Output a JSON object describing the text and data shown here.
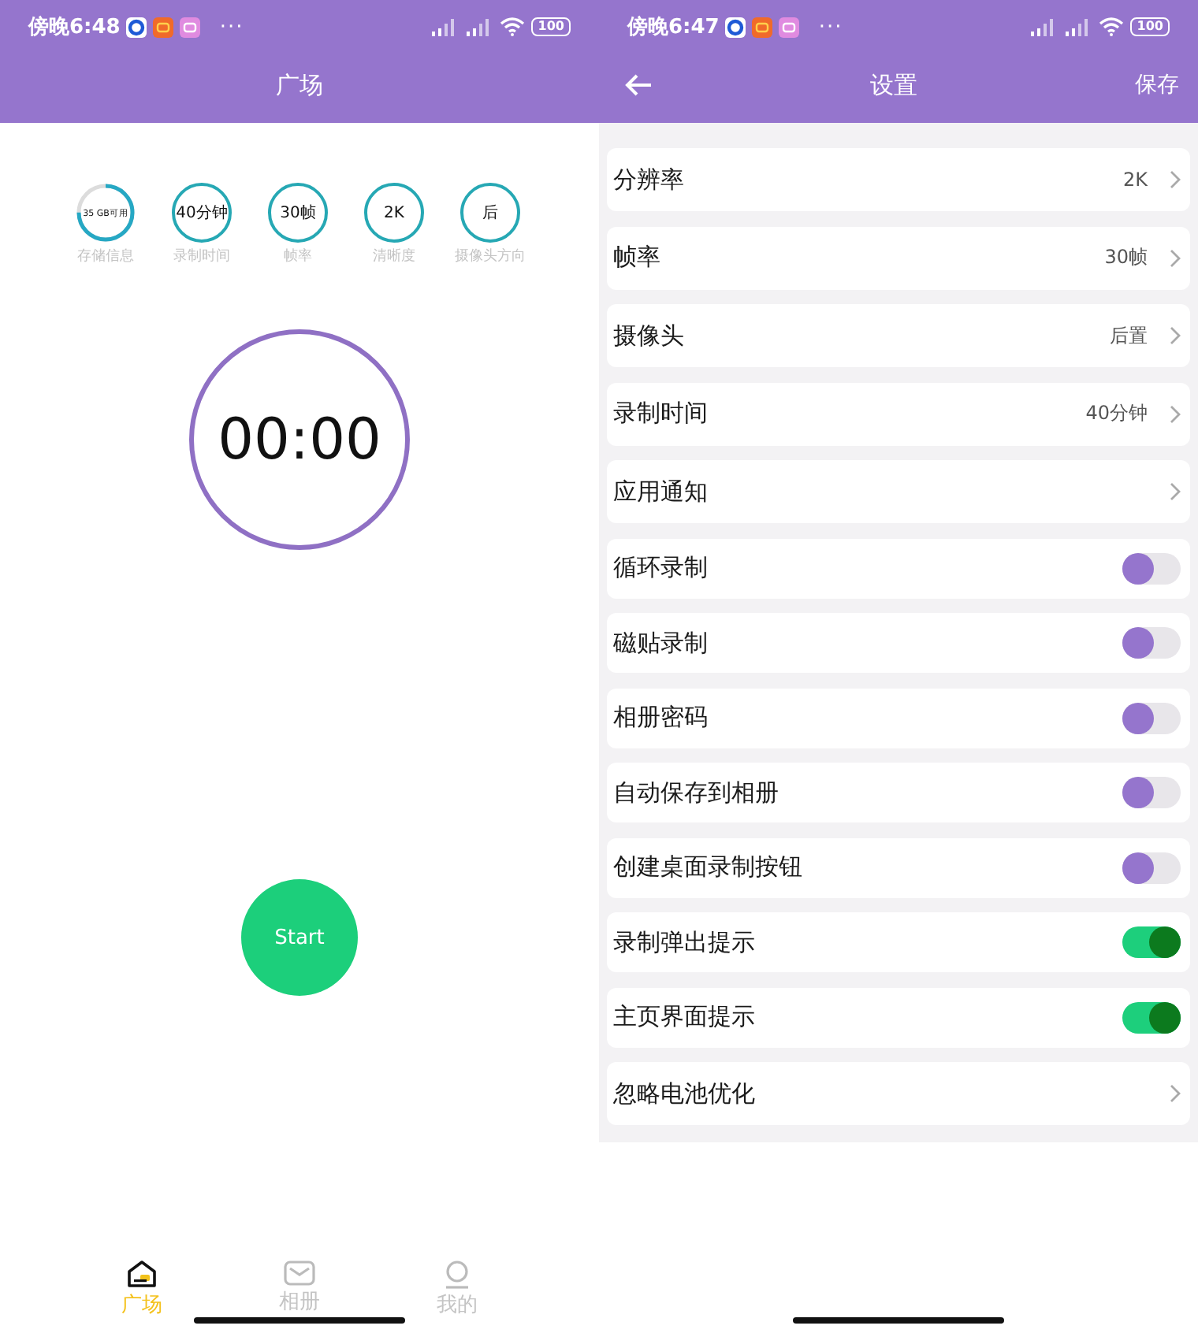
{
  "home_screen": {
    "status_bar": {
      "time": "傍晚6:48",
      "more": "···",
      "battery": "100"
    },
    "title": "广场",
    "stats": [
      {
        "kind": "ring",
        "value": "35 GB可用",
        "level": 0.75,
        "label": "存储信息"
      },
      {
        "kind": "circle",
        "value": "40分钟",
        "label": "录制时间"
      },
      {
        "kind": "circle",
        "value": "30帧",
        "label": "帧率"
      },
      {
        "kind": "circle",
        "value": "2K",
        "label": "清晰度"
      },
      {
        "kind": "circle",
        "value": "后",
        "label": "摄像头方向"
      }
    ],
    "timer": "00:00",
    "start_button": "Start",
    "nav": [
      {
        "label": "广场",
        "selected": true
      },
      {
        "label": "相册",
        "selected": false
      },
      {
        "label": "我的",
        "selected": false
      }
    ]
  },
  "settings_screen": {
    "status_bar": {
      "time": "傍晚6:47",
      "more": "···",
      "battery": "100"
    },
    "title": "设置",
    "save": "保存",
    "rows": [
      {
        "kind": "link",
        "label": "分辨率",
        "value": "2K"
      },
      {
        "kind": "link",
        "label": "帧率",
        "value": "30帧"
      },
      {
        "kind": "link",
        "label": "摄像头",
        "value": "后置"
      },
      {
        "kind": "link",
        "label": "录制时间",
        "value": "40分钟"
      },
      {
        "kind": "link",
        "label": "应用通知"
      },
      {
        "kind": "toggle",
        "label": "循环录制",
        "on": false
      },
      {
        "kind": "toggle",
        "label": "磁贴录制",
        "on": false
      },
      {
        "kind": "toggle",
        "label": "相册密码",
        "on": false
      },
      {
        "kind": "toggle",
        "label": "自动保存到相册",
        "on": false
      },
      {
        "kind": "toggle",
        "label": "创建桌面录制按钮",
        "on": false
      },
      {
        "kind": "toggle",
        "label": "录制弹出提示",
        "on": true
      },
      {
        "kind": "toggle",
        "label": "主页界面提示",
        "on": true
      },
      {
        "kind": "link",
        "label": "忽略电池优化"
      }
    ]
  }
}
